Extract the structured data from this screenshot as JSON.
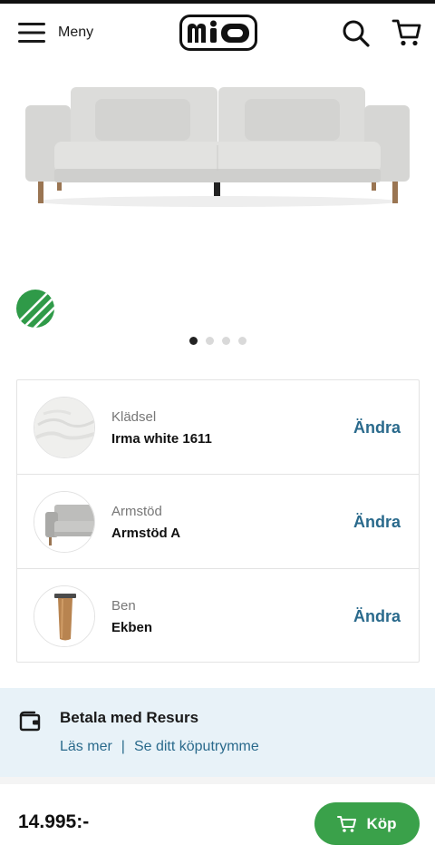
{
  "header": {
    "menu_label": "Meny",
    "logo_text": "mio"
  },
  "carousel": {
    "slide_count": 4,
    "active_index": 0
  },
  "options": [
    {
      "kicker": "Klädsel",
      "value": "Irma white 1611",
      "action": "Ändra",
      "thumb": "fabric-swatch"
    },
    {
      "kicker": "Armstöd",
      "value": "Armstöd A",
      "action": "Ändra",
      "thumb": "armrest-preview"
    },
    {
      "kicker": "Ben",
      "value": "Ekben",
      "action": "Ändra",
      "thumb": "wooden-leg-preview"
    }
  ],
  "payment": {
    "title": "Betala med Resurs",
    "link_read_more": "Läs mer",
    "separator": "|",
    "link_credit": "Se ditt köputrymme"
  },
  "purchase": {
    "price": "14.995:-",
    "buy_label": "Köp"
  },
  "colors": {
    "accent_link": "#2a6a8c",
    "buy_green": "#3aa14a",
    "payment_bg": "#e8f2f8"
  }
}
